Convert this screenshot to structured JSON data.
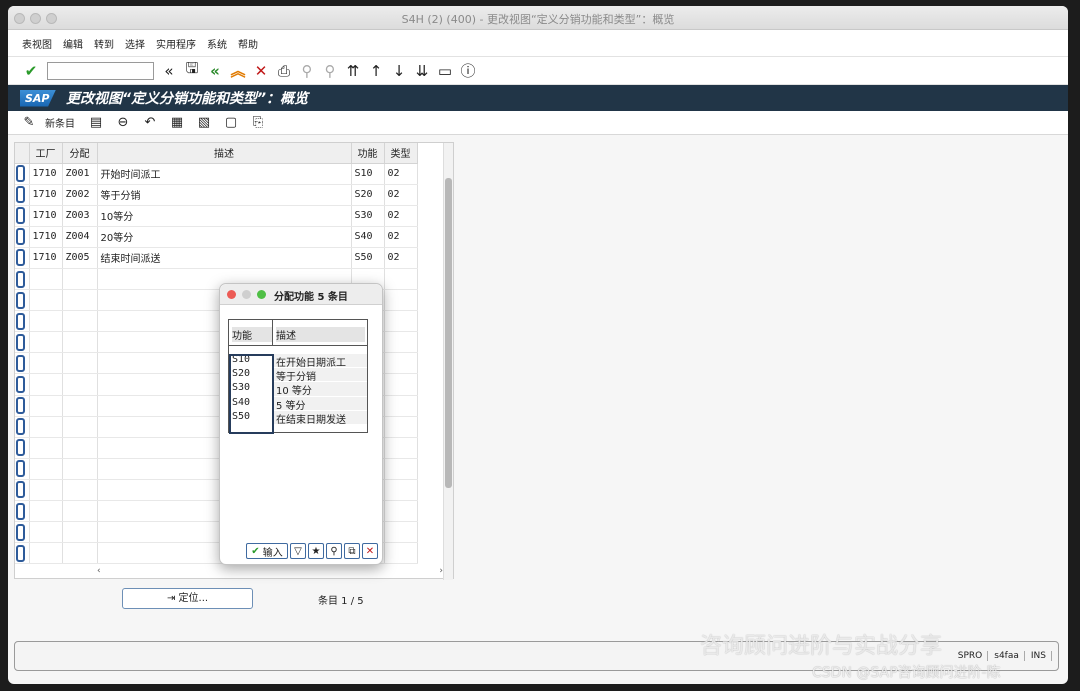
{
  "window": {
    "title": "S4H (2) (400) - 更改视图“定义分销功能和类型”：概览"
  },
  "menu": [
    "表视图",
    "编辑",
    "转到",
    "选择",
    "实用程序",
    "系统",
    "帮助"
  ],
  "screen": {
    "title": "更改视图“定义分销功能和类型”：概览",
    "sap_logo": "SAP"
  },
  "app_toolbar": {
    "new_entries": "新条目"
  },
  "grid": {
    "headers": {
      "plant": "工厂",
      "assign": "分配",
      "desc": "描述",
      "func": "功能",
      "type": "类型"
    },
    "rows": [
      {
        "plant": "1710",
        "assign": "Z001",
        "desc": "开始时间派工",
        "func": "S10",
        "type": "02"
      },
      {
        "plant": "1710",
        "assign": "Z002",
        "desc": "等于分销",
        "func": "S20",
        "type": "02"
      },
      {
        "plant": "1710",
        "assign": "Z003",
        "desc": "10等分",
        "func": "S30",
        "type": "02"
      },
      {
        "plant": "1710",
        "assign": "Z004",
        "desc": "20等分",
        "func": "S40",
        "type": "02"
      },
      {
        "plant": "1710",
        "assign": "Z005",
        "desc": "结束时间派送",
        "func": "S50",
        "type": "02"
      }
    ]
  },
  "position_button": "定位...",
  "entry_count": "条目 1 / 5",
  "status_bar": {
    "tcode": "SPRO",
    "server": "s4faa",
    "mode": "INS"
  },
  "popup": {
    "title": "分配功能 5 条目",
    "headers": {
      "func": "功能",
      "desc": "描述"
    },
    "rows": [
      {
        "func": "S10",
        "desc": "在开始日期派工"
      },
      {
        "func": "S20",
        "desc": "等于分销"
      },
      {
        "func": "S30",
        "desc": "10 等分"
      },
      {
        "func": "S40",
        "desc": "5 等分"
      },
      {
        "func": "S50",
        "desc": "在结束日期发送"
      }
    ],
    "enter_label": "输入"
  },
  "watermark": {
    "line1": "咨询顾问进阶与实战分享",
    "line2": "CSDN @SAP咨询顾问进阶-陈"
  }
}
